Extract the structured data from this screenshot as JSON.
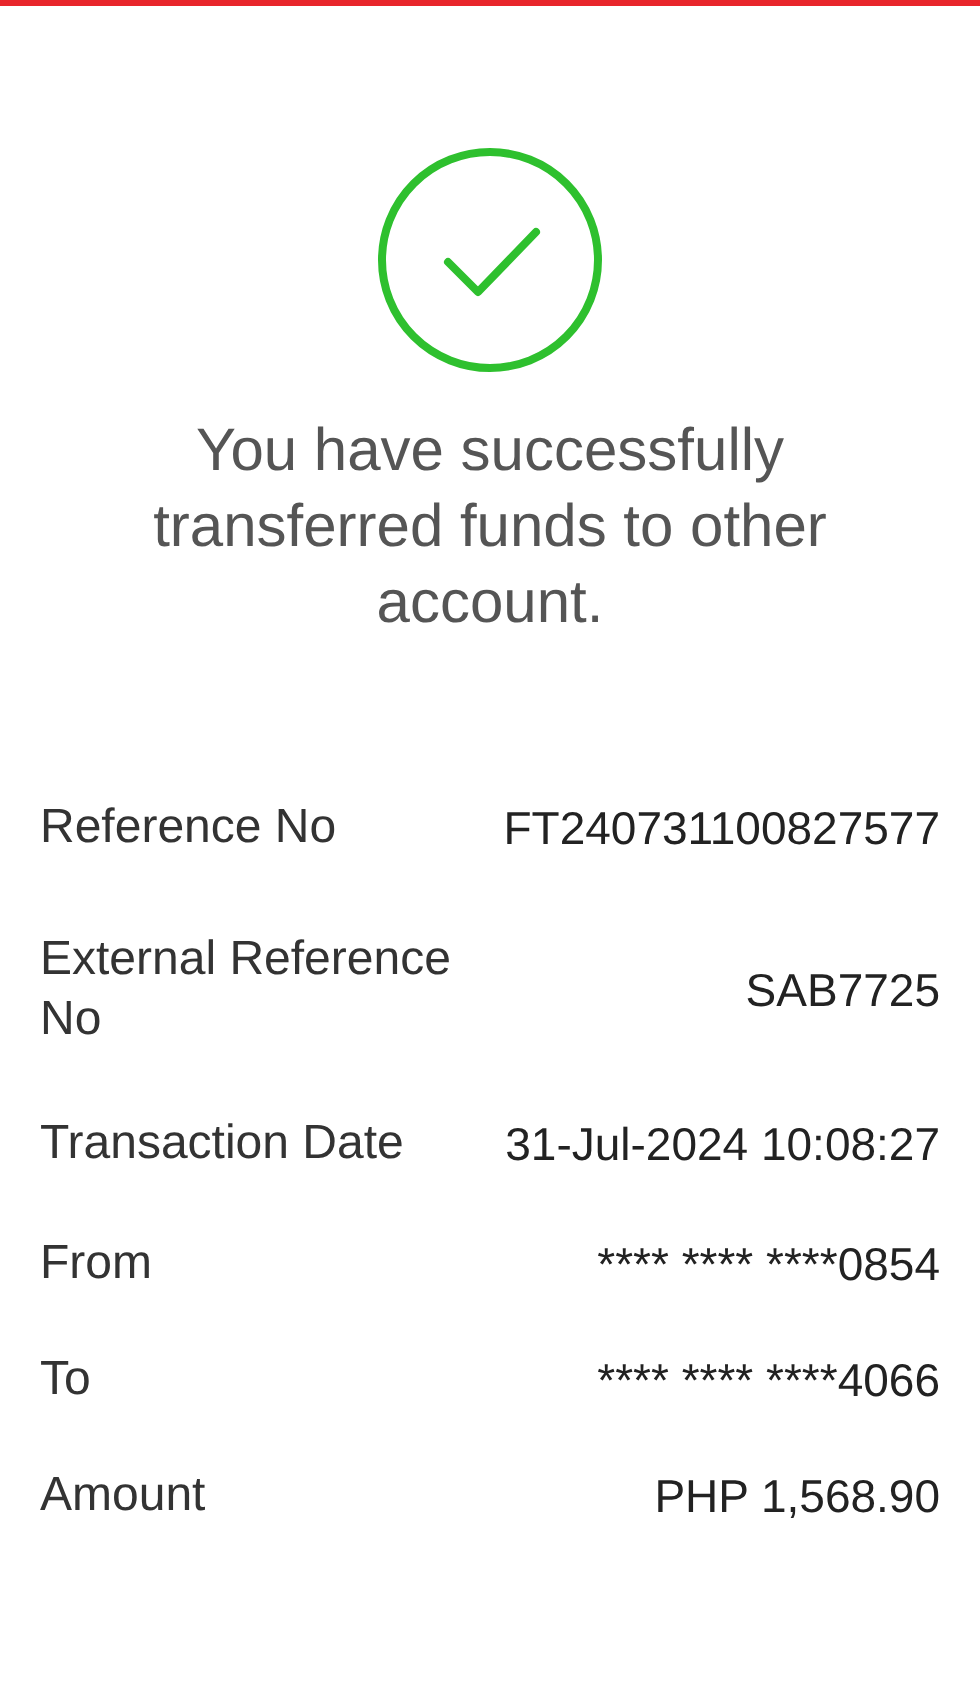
{
  "message": "You have successfully transferred funds to other account.",
  "details": [
    {
      "label": "Reference No",
      "value": "FT240731100827577"
    },
    {
      "label": "External Reference No",
      "value": "SAB7725"
    },
    {
      "label": "Transaction Date",
      "value": "31-Jul-2024 10:08:27"
    },
    {
      "label": "From",
      "value": "**** **** ****0854"
    },
    {
      "label": "To",
      "value": "**** **** ****4066"
    },
    {
      "label": "Amount",
      "value": "PHP 1,568.90"
    }
  ]
}
